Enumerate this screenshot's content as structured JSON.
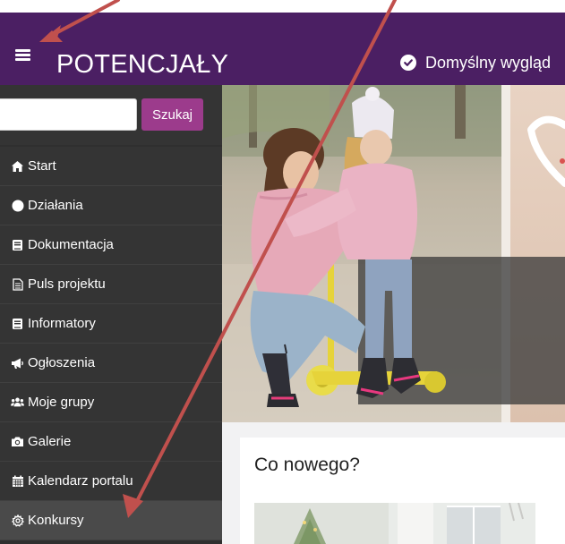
{
  "header": {
    "brand": "POTENCJAŁY",
    "theme_label": "Domyślny wygląd",
    "menu_icon": "hamburger-menu-icon",
    "theme_icon": "check-circle-icon",
    "background_color": "#4b1f63"
  },
  "search": {
    "value": "",
    "button_label": "Szukaj",
    "button_color": "#9c3b8c"
  },
  "sidebar": {
    "items": [
      {
        "label": "Start",
        "icon": "home-icon"
      },
      {
        "label": "Działania",
        "icon": "circle-icon"
      },
      {
        "label": "Dokumentacja",
        "icon": "book-icon"
      },
      {
        "label": "Puls projektu",
        "icon": "document-icon"
      },
      {
        "label": "Informatory",
        "icon": "book-icon"
      },
      {
        "label": "Ogłoszenia",
        "icon": "megaphone-icon"
      },
      {
        "label": "Moje grupy",
        "icon": "users-icon"
      },
      {
        "label": "Galerie",
        "icon": "camera-icon"
      },
      {
        "label": "Kalendarz portalu",
        "icon": "calendar-icon"
      },
      {
        "label": "Konkursy",
        "icon": "gear-icon",
        "active": true
      }
    ]
  },
  "main": {
    "news_title": "Co nowego?"
  },
  "annotation": {
    "arrow_color": "#c0504d"
  }
}
